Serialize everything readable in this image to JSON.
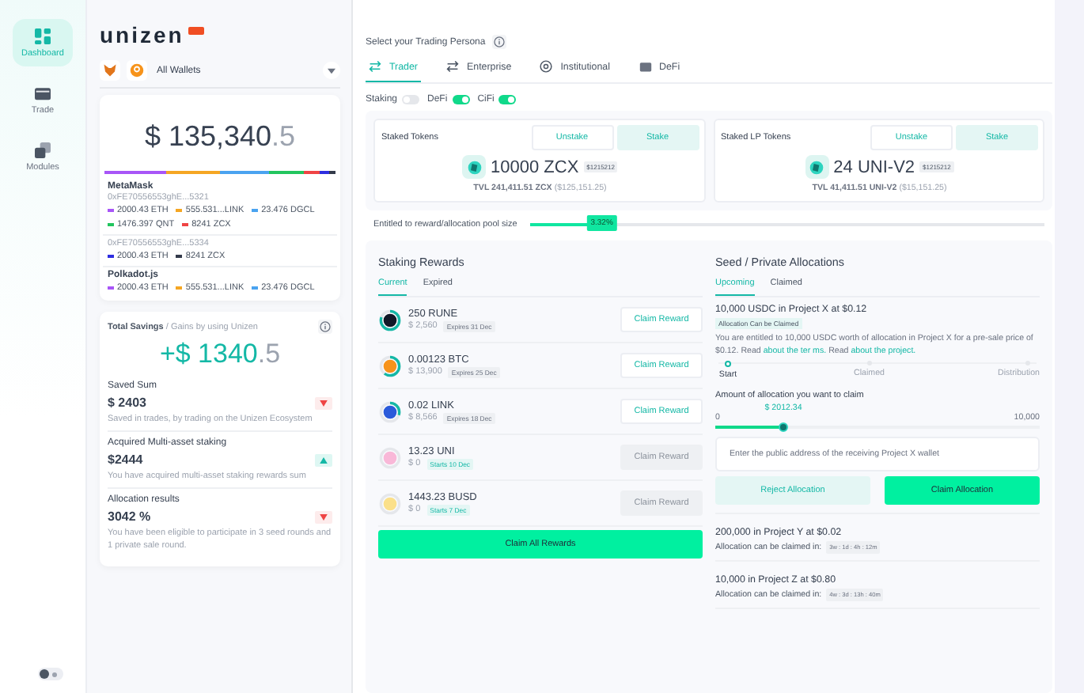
{
  "nav": [
    {
      "label": "Dashboard",
      "selected": true
    },
    {
      "label": "Trade",
      "selected": false
    },
    {
      "label": "Modules",
      "selected": false
    }
  ],
  "theme_toggle": {
    "on": false
  },
  "brand": {
    "name": "unizen"
  },
  "wallet_selector": {
    "label": "All Wallets"
  },
  "portfolio": {
    "total": "$ 135,340",
    "total_decimal": ".5",
    "bar": [
      {
        "color": "#a855f7"
      },
      {
        "color": "#f5a623"
      },
      {
        "color": "#4aa3f0"
      },
      {
        "color": "#22c55e"
      },
      {
        "color": "#ef4444"
      },
      {
        "color": "#2e2ee0"
      },
      {
        "color": "#333a4a"
      }
    ],
    "wallets": [
      {
        "name": "MetaMask",
        "address": "0xFE70556553ghE...5321",
        "assets": [
          {
            "text": "2000.43 ETH",
            "color": "#a855f7"
          },
          {
            "text": "555.531...LINK",
            "color": "#f5a623"
          },
          {
            "text": "23.476 DGCL",
            "color": "#4aa3f0"
          },
          {
            "text": "1476.397 QNT",
            "color": "#22c55e"
          },
          {
            "text": "8241 ZCX",
            "color": "#ef4444"
          }
        ]
      },
      {
        "address": "0xFE70556553ghE...5334",
        "assets": [
          {
            "text": "2000.43 ETH",
            "color": "#2e2ee0"
          },
          {
            "text": "8241 ZCX",
            "color": "#333a4a"
          }
        ]
      },
      {
        "name": "Polkadot.js",
        "assets": [
          {
            "text": "2000.43 ETH",
            "color": "#a855f7"
          },
          {
            "text": "555.531...LINK",
            "color": "#f5a623"
          },
          {
            "text": "23.476 DGCL",
            "color": "#4aa3f0"
          }
        ]
      }
    ]
  },
  "savings": {
    "title": "Total Savings",
    "subtitle": "/ Gains by using Unizen",
    "amount": "+$ 1340",
    "amount_decimal": ".5",
    "items": [
      {
        "title": "Saved Sum",
        "value": "$ 2403",
        "up": false,
        "description": "Saved in trades, by trading on the Unizen Ecosystem"
      },
      {
        "title": "Acquired Multi-asset staking",
        "value": "$2444",
        "up": true,
        "description": "You have acquired multi-asset staking rewards sum"
      },
      {
        "title": "Allocation results",
        "value": "3042 %",
        "up": false,
        "description": "You have been eligible to participate in 3 seed rounds and 1 private sale round."
      }
    ]
  },
  "persona": {
    "label": "Select your Trading Persona",
    "tabs": [
      {
        "label": "Trader",
        "selected": true
      },
      {
        "label": "Enterprise",
        "selected": false
      },
      {
        "label": "Institutional",
        "selected": false
      },
      {
        "label": "DeFi",
        "selected": false
      }
    ],
    "toggles": [
      {
        "label": "Staking",
        "on": false
      },
      {
        "label": "DeFi",
        "on": true
      },
      {
        "label": "CiFi",
        "on": true
      }
    ]
  },
  "staked": [
    {
      "title": "Staked Tokens",
      "actions": [
        {
          "label": "Unstake",
          "selected": false
        },
        {
          "label": "Stake",
          "selected": true
        }
      ],
      "amount": "10000 ZCX",
      "tag": "$1215212",
      "tvl": "TVL 241,411.51 ZCX",
      "tvl_usd": "($125,151.25)"
    },
    {
      "title": "Staked LP Tokens",
      "actions": [
        {
          "label": "Unstake",
          "selected": false
        },
        {
          "label": "Stake",
          "selected": true
        }
      ],
      "amount": "24 UNI-V2",
      "tag": "$1215212",
      "tvl": "TVL 41,411.51 UNI-V2",
      "tvl_usd": "($15,151.25)"
    }
  ],
  "pool": {
    "label": "Entitled to reward/allocation pool size",
    "level": 0.14,
    "reading": "3.32%"
  },
  "rewards": {
    "title": "Staking Rewards",
    "tabs": [
      {
        "label": "Current",
        "selected": true
      },
      {
        "label": "Expired",
        "selected": false
      }
    ],
    "items": [
      {
        "amount": "250 RUNE",
        "usd": "$ 2,560",
        "tag": "Expires 31 Dec",
        "upcoming": false,
        "color": "#111827",
        "button": "Claim Reward",
        "disabled": false
      },
      {
        "amount": "0.00123 BTC",
        "usd": "$ 13,900",
        "tag": "Expires 25 Dec",
        "upcoming": false,
        "color": "#f7931a",
        "button": "Claim Reward",
        "disabled": false
      },
      {
        "amount": "0.02 LINK",
        "usd": "$ 8,566",
        "tag": "Expires 18 Dec",
        "upcoming": false,
        "color": "#2a5ada",
        "button": "Claim Reward",
        "disabled": false
      },
      {
        "amount": "13.23 UNI",
        "usd": "$ 0",
        "tag": "Starts 10 Dec",
        "upcoming": true,
        "color": "#f9b8d8",
        "button": "Claim Reward",
        "disabled": true
      },
      {
        "amount": "1443.23 BUSD",
        "usd": "$ 0",
        "tag": "Starts 7 Dec",
        "upcoming": true,
        "color": "#fbe08a",
        "button": "Claim Reward",
        "disabled": true
      }
    ],
    "claim_all": "Claim All Rewards"
  },
  "allocations": {
    "title": "Seed / Private Allocations",
    "tabs": [
      {
        "label": "Upcoming",
        "selected": true
      },
      {
        "label": "Claimed",
        "selected": false
      }
    ],
    "current": {
      "title": "10,000 USDC in Project X at $0.12",
      "badge": "Allocation Can be Claimed",
      "description": [
        {
          "text": "You are entitled to 10,000 USDC worth of allocation in Project X for a pre-sale price of $0.12. Read ",
          "link": false
        },
        {
          "text": "about the ter ms.",
          "link": true
        },
        {
          "text": " Read ",
          "link": false
        },
        {
          "text": "about the project.",
          "link": true
        }
      ],
      "steps": [
        {
          "label": "Start",
          "done": true
        },
        {
          "label": "Claimed",
          "done": false
        },
        {
          "label": "Distribution",
          "done": false
        }
      ],
      "amount_label": "Amount of allocation you want to claim",
      "min": "0",
      "max": "10,000",
      "value": "$ 2012.34",
      "level": 0.21,
      "address_placeholder": "Enter the public address of the receiving Project X wallet",
      "reject": "Reject Allocation",
      "claim": "Claim Allocation"
    },
    "upcoming": [
      {
        "title": "200,000 in Project Y at $0.02",
        "label": "Allocation can be claimed in:",
        "countdown": "3w : 1d : 4h : 12m"
      },
      {
        "title": "10,000 in Project Z at $0.80",
        "label": "Allocation can be claimed in:",
        "countdown": "4w : 3d : 13h : 40m"
      }
    ]
  }
}
